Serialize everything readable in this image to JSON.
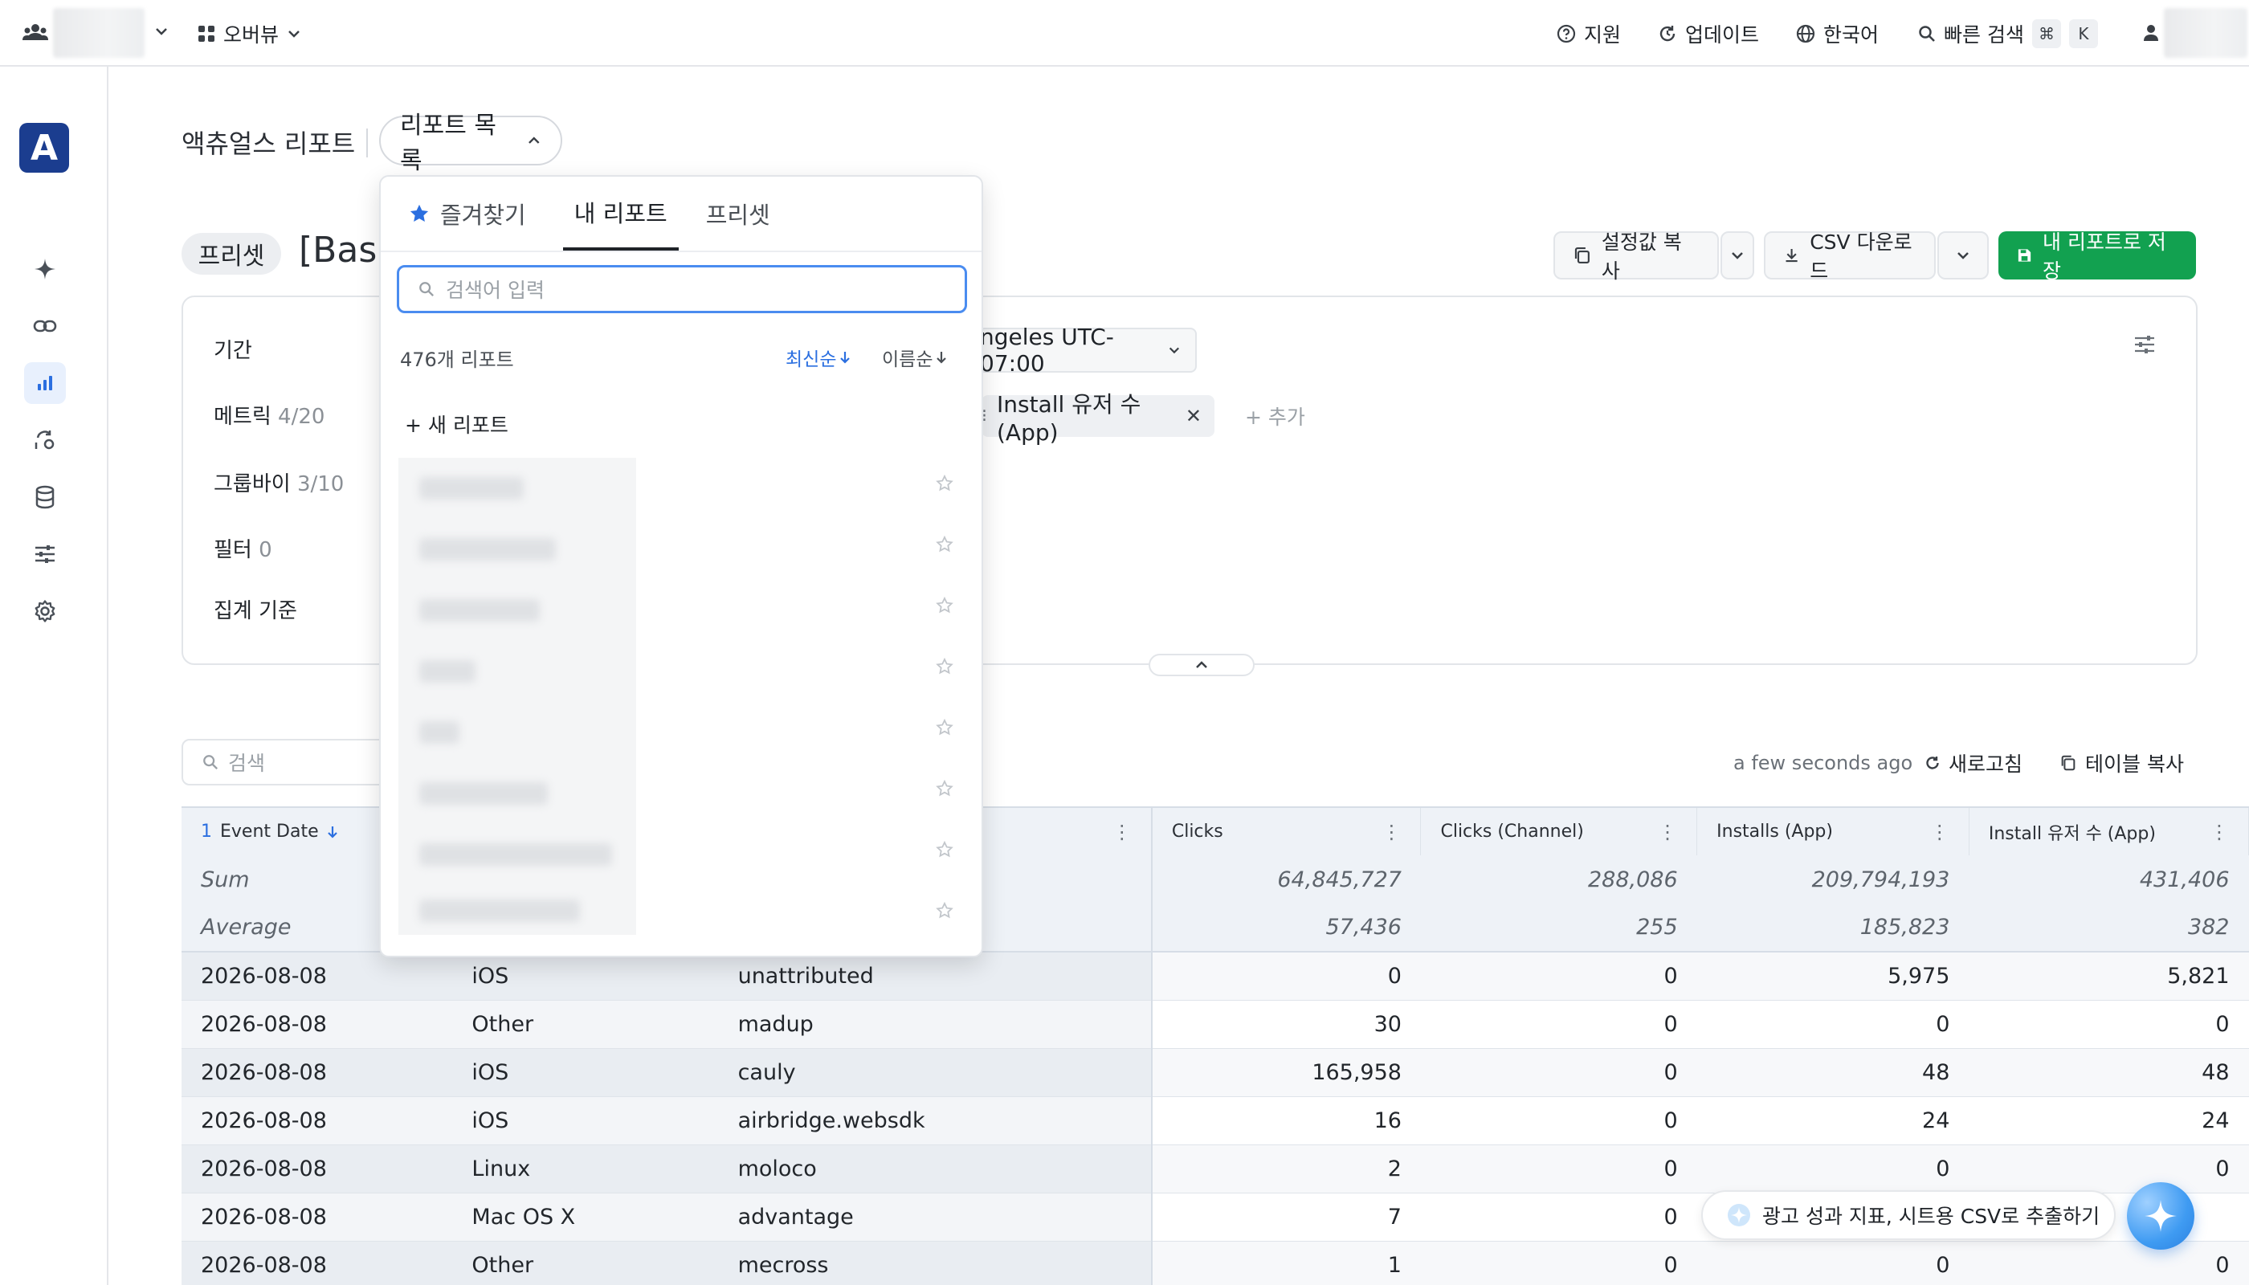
{
  "topbar": {
    "overview_label": "오버뷰",
    "support_label": "지원",
    "updates_label": "업데이트",
    "language_label": "한국어",
    "quick_search_label": "빠른 검색",
    "shortcut_keys": [
      "⌘",
      "K"
    ]
  },
  "sidebar": {
    "logo_letter": "A",
    "items": [
      "sparkle-icon",
      "link-icon",
      "bar-chart-icon",
      "sync-icon",
      "database-icon",
      "sliders-icon",
      "gear-icon"
    ],
    "active_item": "bar-chart-icon"
  },
  "header": {
    "breadcrumb": "액츄얼스 리포트",
    "report_list_label": "리포트 목록",
    "preset_chip": "프리셋",
    "report_title_partial": "[Basi"
  },
  "actions": {
    "copy_settings_label": "설정값 복사",
    "csv_download_label": "CSV 다운로드",
    "save_label": "내 리포트로 저장"
  },
  "settings_panel": {
    "period_label": "기간",
    "metrics_label": "메트릭",
    "metrics_count": "4/20",
    "groupby_label": "그룹바이",
    "groupby_count": "3/10",
    "filter_label": "필터",
    "filter_count": "0",
    "aggregate_label": "집계 기준",
    "timezone_partial": "ngeles UTC-07:00",
    "metric_chip_partial": "Install 유저 수 (App)",
    "add_label": "+ 추가"
  },
  "table_toolbar": {
    "search_placeholder": "검색",
    "updated_text": "a few seconds ago",
    "refresh_label": "새로고침",
    "copy_table_label": "테이블 복사"
  },
  "table": {
    "sort_index": "1",
    "columns": [
      "Event Date",
      "",
      "",
      "Clicks",
      "Clicks (Channel)",
      "Installs (App)",
      "Install 유저 수 (App)"
    ],
    "sum_label": "Sum",
    "average_label": "Average",
    "sum_values": [
      "64,845,727",
      "288,086",
      "209,794,193",
      "431,406"
    ],
    "average_values": [
      "57,436",
      "255",
      "185,823",
      "382"
    ],
    "rows": [
      [
        "2026-08-08",
        "iOS",
        "unattributed",
        "0",
        "0",
        "5,975",
        "5,821"
      ],
      [
        "2026-08-08",
        "Other",
        "madup",
        "30",
        "0",
        "0",
        "0"
      ],
      [
        "2026-08-08",
        "iOS",
        "cauly",
        "165,958",
        "0",
        "48",
        "48"
      ],
      [
        "2026-08-08",
        "iOS",
        "airbridge.websdk",
        "16",
        "0",
        "24",
        "24"
      ],
      [
        "2026-08-08",
        "Linux",
        "moloco",
        "2",
        "0",
        "0",
        "0"
      ],
      [
        "2026-08-08",
        "Mac OS X",
        "advantage",
        "7",
        "0",
        "",
        ""
      ],
      [
        "2026-08-08",
        "Other",
        "mecross",
        "1",
        "0",
        "0",
        "0"
      ]
    ]
  },
  "dropdown": {
    "tabs": [
      "즐겨찾기",
      "내 리포트",
      "프리셋"
    ],
    "active_tab": "내 리포트",
    "search_placeholder": "검색어 입력",
    "count_text": "476개 리포트",
    "sort_latest": "최신순",
    "sort_name": "이름순",
    "new_report_label": "+ 새 리포트",
    "report_rows": 8
  },
  "assistant": {
    "prompt_label": "광고 성과 지표, 시트용 CSV로 추출하기"
  },
  "colors": {
    "primary_green": "#12a150",
    "link_blue": "#2b6fe0",
    "focus_blue": "#4a8cf0",
    "logo_navy": "#1b3d8f"
  }
}
